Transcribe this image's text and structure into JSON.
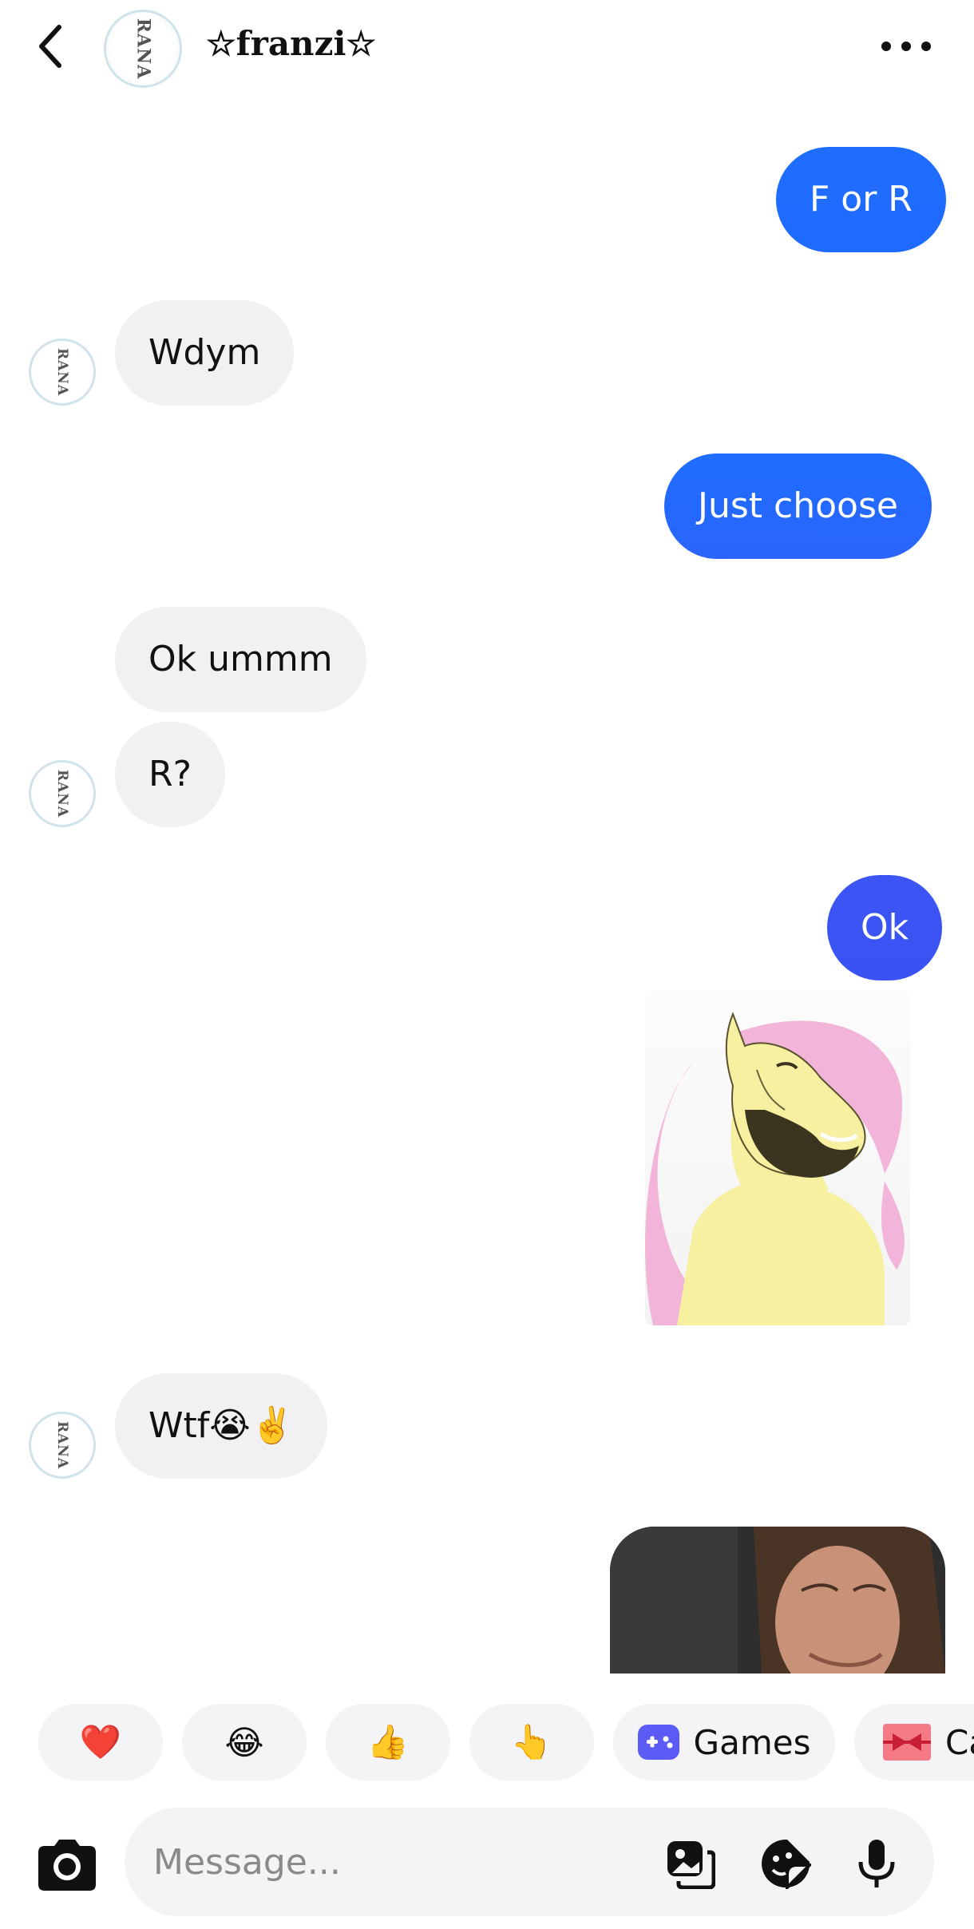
{
  "header": {
    "name": "☆franzi☆",
    "avatar_text": "RANA",
    "icons": {
      "back": "chevron-left-icon",
      "more": "more-horizontal-icon"
    }
  },
  "messages": [
    {
      "direction": "out",
      "text": "F or R"
    },
    {
      "direction": "in",
      "text": "Wdym"
    },
    {
      "direction": "out",
      "text": "Just choose"
    },
    {
      "direction": "in",
      "text": "Ok ummm"
    },
    {
      "direction": "in",
      "text": "R?"
    },
    {
      "direction": "out",
      "text": "Ok"
    },
    {
      "direction": "out",
      "type": "sticker"
    },
    {
      "direction": "in",
      "text": "Wtf😭✌️"
    },
    {
      "direction": "out",
      "type": "photo"
    }
  ],
  "quick_replies": [
    "❤️",
    "😂",
    "👍",
    "👆"
  ],
  "quick_actions": [
    {
      "label": "Games",
      "icon": "gamepad-icon"
    },
    {
      "label": "Ca",
      "icon": "gift-card-icon"
    }
  ],
  "composer": {
    "placeholder": "Message...",
    "icons": [
      "camera-icon",
      "gallery-icon",
      "sticker-icon",
      "microphone-icon"
    ]
  },
  "colors": {
    "bubble_out_gradient_top": "#1f6dff",
    "bubble_out_gradient_bottom": "#3b5bf5",
    "bubble_in": "#f1f1f3",
    "background": "#ffffff"
  }
}
